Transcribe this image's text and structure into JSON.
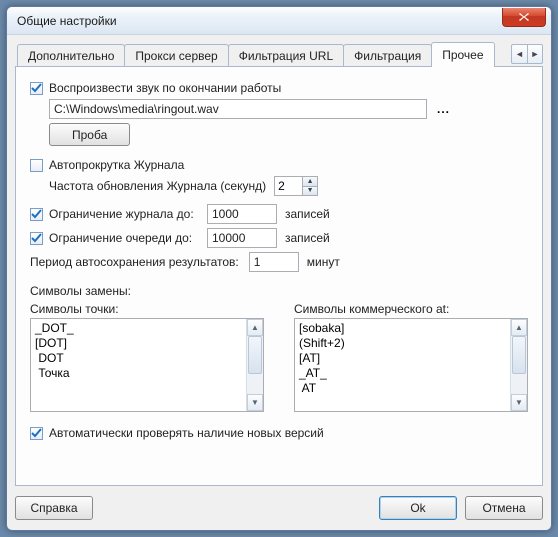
{
  "window": {
    "title": "Общие настройки"
  },
  "tabs": {
    "items": [
      {
        "label": "Дополнительно"
      },
      {
        "label": "Прокси сервер"
      },
      {
        "label": "Фильтрация URL"
      },
      {
        "label": "Фильтрация"
      },
      {
        "label": "Прочее"
      }
    ],
    "active_index": 4
  },
  "sound": {
    "checkbox_label": "Воспроизвести звук по окончании работы",
    "checked": true,
    "path": "C:\\Windows\\media\\ringout.wav",
    "browse_label": "...",
    "test_button": "Проба"
  },
  "autoscroll": {
    "checkbox_label": "Автопрокрутка Журнала",
    "checked": false,
    "freq_label": "Частота обновления Журнала (секунд)",
    "freq_value": "2"
  },
  "journal_limit": {
    "checkbox_label": "Ограничение журнала до:",
    "checked": true,
    "value": "1000",
    "unit": "записей"
  },
  "queue_limit": {
    "checkbox_label": "Ограничение очереди до:",
    "checked": true,
    "value": "10000",
    "unit": "записей"
  },
  "autosave": {
    "label": "Период автосохранения результатов:",
    "value": "1",
    "unit": "минут"
  },
  "replace": {
    "header": "Символы замены:",
    "dot_label": "Символы точки:",
    "dot_items": [
      "_DOT_",
      "[DOT]",
      " DOT",
      " Точка"
    ],
    "at_label": "Символы коммерческого at:",
    "at_items": [
      "[sobaka]",
      "(Shift+2)",
      "[AT]",
      "_AT_",
      " AT"
    ]
  },
  "autoupdate": {
    "checkbox_label": "Автоматически проверять наличие новых версий",
    "checked": true
  },
  "buttons": {
    "help": "Справка",
    "ok": "Ok",
    "cancel": "Отмена"
  }
}
